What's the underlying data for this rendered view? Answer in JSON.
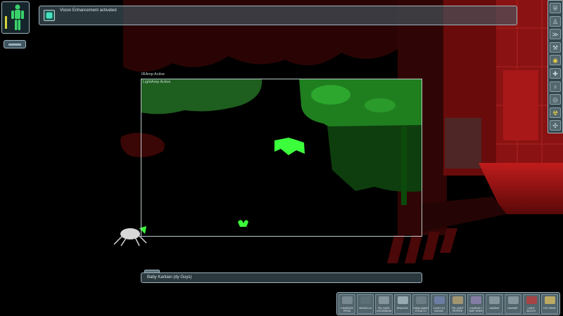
{
  "hud": {
    "message": "Vision Enhancement activated",
    "message_icon": "vision-aug-icon",
    "iramp_label": "IRAmp Active",
    "lightamp_label": "LightAmp Active",
    "target_label": "Baby Karkian (dy Guys)"
  },
  "augmentations": [
    {
      "icon": "ballistic-shield-icon",
      "glyph": "⛨",
      "color": "#c8d8dc"
    },
    {
      "icon": "body-aug-icon",
      "glyph": "♙",
      "color": "#c8d8dc"
    },
    {
      "icon": "speed-aug-icon",
      "glyph": "≫",
      "color": "#c8d8dc"
    },
    {
      "icon": "wrench-aug-icon",
      "glyph": "⚒",
      "color": "#c8d8dc"
    },
    {
      "icon": "vision-aug-icon",
      "glyph": "◉",
      "color": "#e8d14a"
    },
    {
      "icon": "target-aug-icon",
      "glyph": "✚",
      "color": "#c8d8dc"
    },
    {
      "icon": "lungs-aug-icon",
      "glyph": "♆",
      "color": "#c8d8dc"
    },
    {
      "icon": "energy-shield-icon",
      "glyph": "◎",
      "color": "#c8d8dc"
    },
    {
      "icon": "radiation-aug-icon",
      "glyph": "☢",
      "color": "#e8d14a"
    },
    {
      "icon": "spy-drone-icon",
      "glyph": "✣",
      "color": "#c8d8dc"
    }
  ],
  "inventory": {
    "slots": [
      {
        "label": "CHARGED PROD",
        "icon": "riot-prod-icon",
        "tint": "#7b8c94"
      },
      {
        "label": "BIOCELLS",
        "icon": "biocell-icon",
        "tint": "#5c7078"
      },
      {
        "label": "TRL DART CROSSBOW",
        "icon": "crossbow-icon",
        "tint": "#8a9aa0"
      },
      {
        "label": "DRAGON",
        "icon": "dragon-tooth-sword-icon",
        "tint": "#9fb0b8"
      },
      {
        "label": "10MM AMMO STEALTH",
        "icon": "stealth-pistol-icon",
        "tint": "#6f8088"
      },
      {
        "label": "LIGHT 1X BIOCEL",
        "icon": "lockpick-icon",
        "tint": "#6f7fa8"
      },
      {
        "label": "TRL DART PEPPER",
        "icon": "pepper-gun-icon",
        "tint": "#a89a70"
      },
      {
        "label": "CHARGE 2 EMP GREN",
        "icon": "emp-grenade-icon",
        "tint": "#8a7fa8"
      },
      {
        "label": "HAZMAT",
        "icon": "hazmat-suit-icon",
        "tint": "#8a9aa0"
      },
      {
        "label": "HAZMAT",
        "icon": "hazmat-suit-icon",
        "tint": "#8a9aa0"
      },
      {
        "label": "LIGHT BOOTS",
        "icon": "medkit-icon",
        "tint": "#b04040"
      },
      {
        "label": "KEY RING",
        "icon": "key-ring-icon",
        "tint": "#c8b060"
      }
    ]
  },
  "colors": {
    "hud_frame": "#9fb4bc",
    "vision_green": "#33ff33",
    "scene_red": "#8a1212",
    "health_green": "#3ad26a"
  }
}
